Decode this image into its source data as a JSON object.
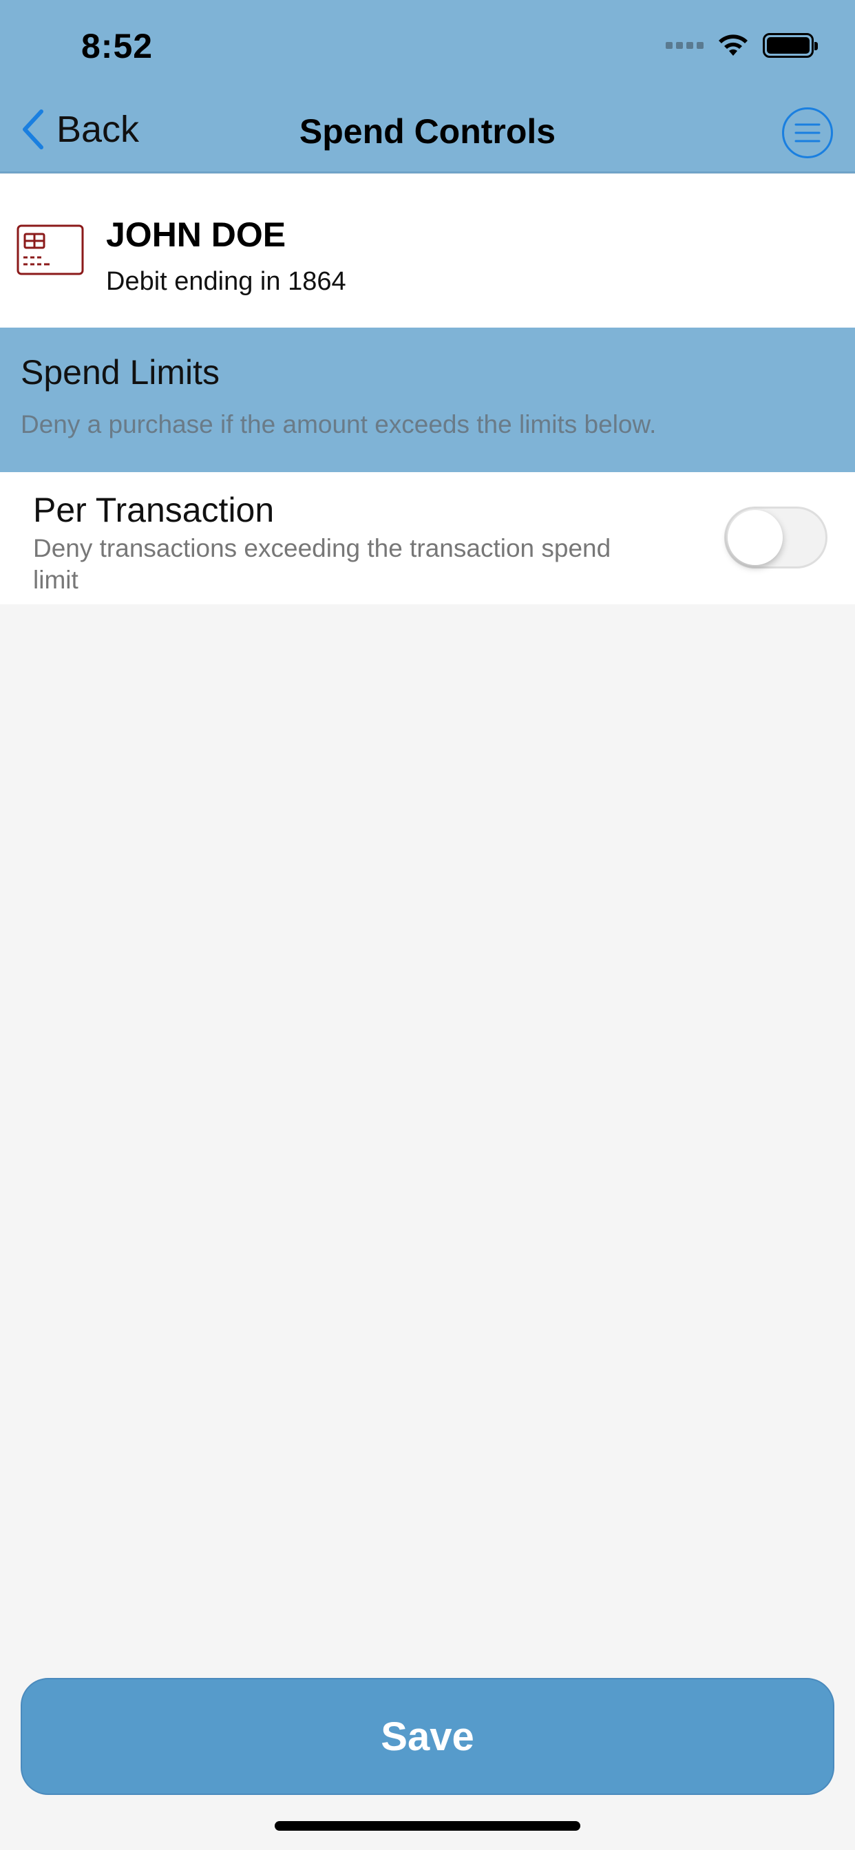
{
  "status_bar": {
    "time": "8:52",
    "signal_icon": "signal-dots-icon",
    "wifi_icon": "wifi-icon",
    "battery_icon": "battery-icon"
  },
  "nav": {
    "back_label": "Back",
    "title": "Spend Controls",
    "menu_icon": "hamburger-menu-icon"
  },
  "card": {
    "icon": "credit-card-icon",
    "name": "JOHN DOE",
    "subtitle": "Debit ending in 1864"
  },
  "spend_limits": {
    "title": "Spend Limits",
    "description": "Deny a purchase if the amount exceeds the limits below.",
    "items": [
      {
        "title": "Per Transaction",
        "description": "Deny transactions exceeding the transaction spend limit",
        "enabled": false
      }
    ]
  },
  "actions": {
    "save_label": "Save"
  },
  "colors": {
    "header_bg": "#7fb3d6",
    "accent_blue": "#1a7fe0",
    "save_button": "#569bcb",
    "card_icon": "#8b1a1a",
    "page_bg": "#f5f5f5"
  }
}
